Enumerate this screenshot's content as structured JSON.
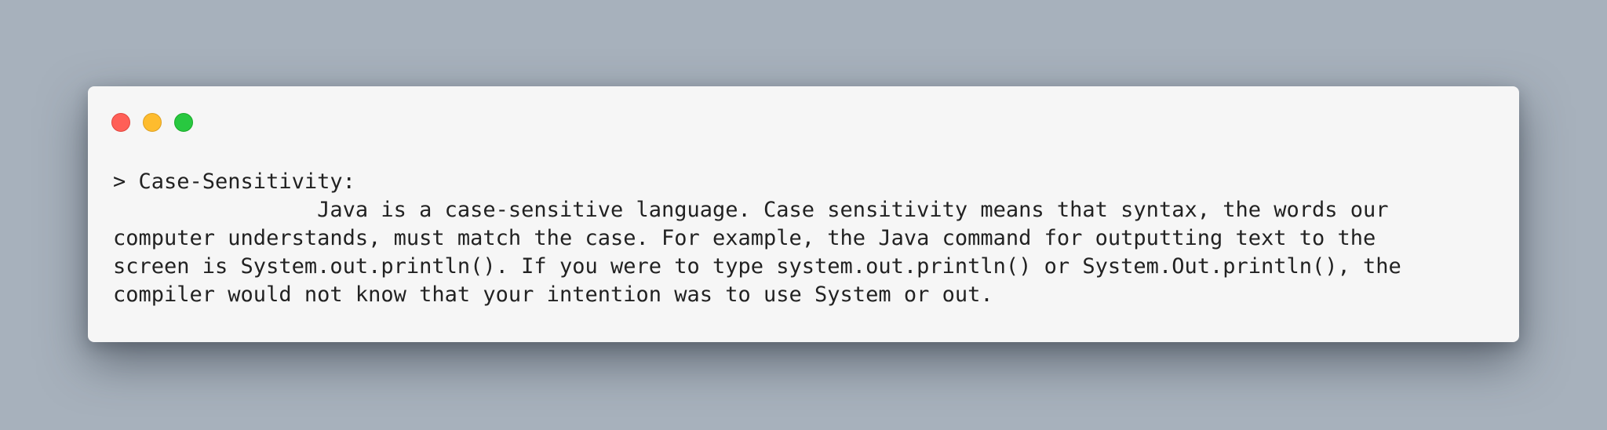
{
  "window": {
    "controls": [
      "close",
      "minimize",
      "zoom"
    ],
    "colors": {
      "close": "#ff5f57",
      "minimize": "#febc2e",
      "zoom": "#28c840",
      "background": "#f6f6f6",
      "desktop": "#a7b1bc"
    }
  },
  "terminal": {
    "lines": [
      "> Case-Sensitivity:",
      "                Java is a case-sensitive language. Case sensitivity means that syntax, the words our",
      "computer understands, must match the case. For example, the Java command for outputting text to the",
      "screen is System.out.println(). If you were to type system.out.println() or System.Out.println(), the",
      "compiler would not know that your intention was to use System or out."
    ]
  }
}
